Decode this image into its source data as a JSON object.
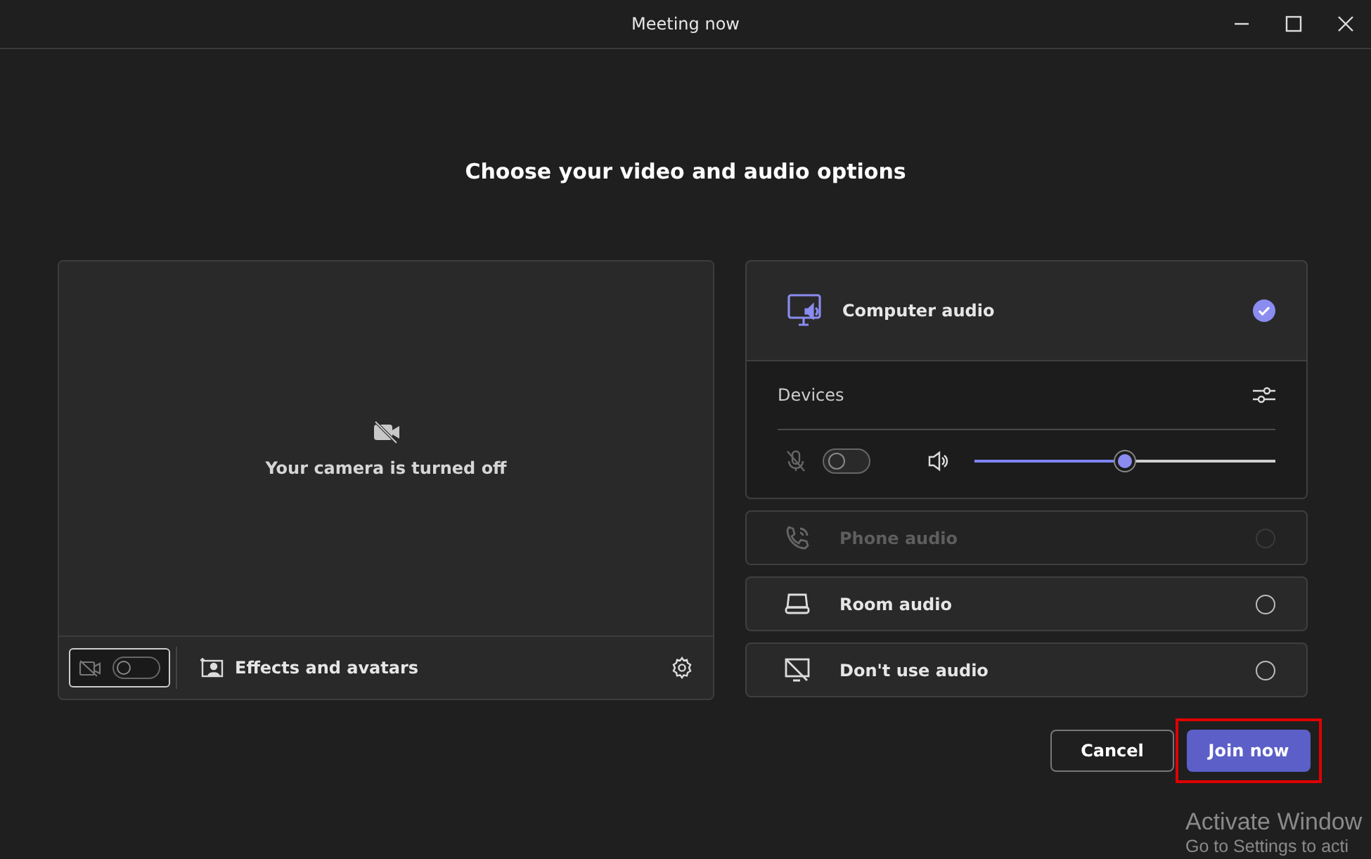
{
  "window": {
    "title": "Meeting now"
  },
  "heading": "Choose your video and audio options",
  "camera": {
    "on": false,
    "message": "Your camera is turned off",
    "effects_label": "Effects and avatars"
  },
  "audio_options": [
    {
      "kind": "computer",
      "label": "Computer audio",
      "selected": true,
      "disabled": false,
      "devices": {
        "label": "Devices",
        "mic_on": false,
        "level": 0.5
      }
    },
    {
      "kind": "phone",
      "label": "Phone audio",
      "selected": false,
      "disabled": true
    },
    {
      "kind": "room",
      "label": "Room audio",
      "selected": false,
      "disabled": false
    },
    {
      "kind": "none",
      "label": "Don't use audio",
      "selected": false,
      "disabled": false
    }
  ],
  "buttons": [
    {
      "kind": "secondary",
      "label": "Cancel",
      "highlighted": false
    },
    {
      "kind": "primary",
      "label": "Join now",
      "highlighted": true
    }
  ],
  "activation_notice": {
    "title": "Activate Window",
    "subtitle": "Go to Settings to acti"
  }
}
